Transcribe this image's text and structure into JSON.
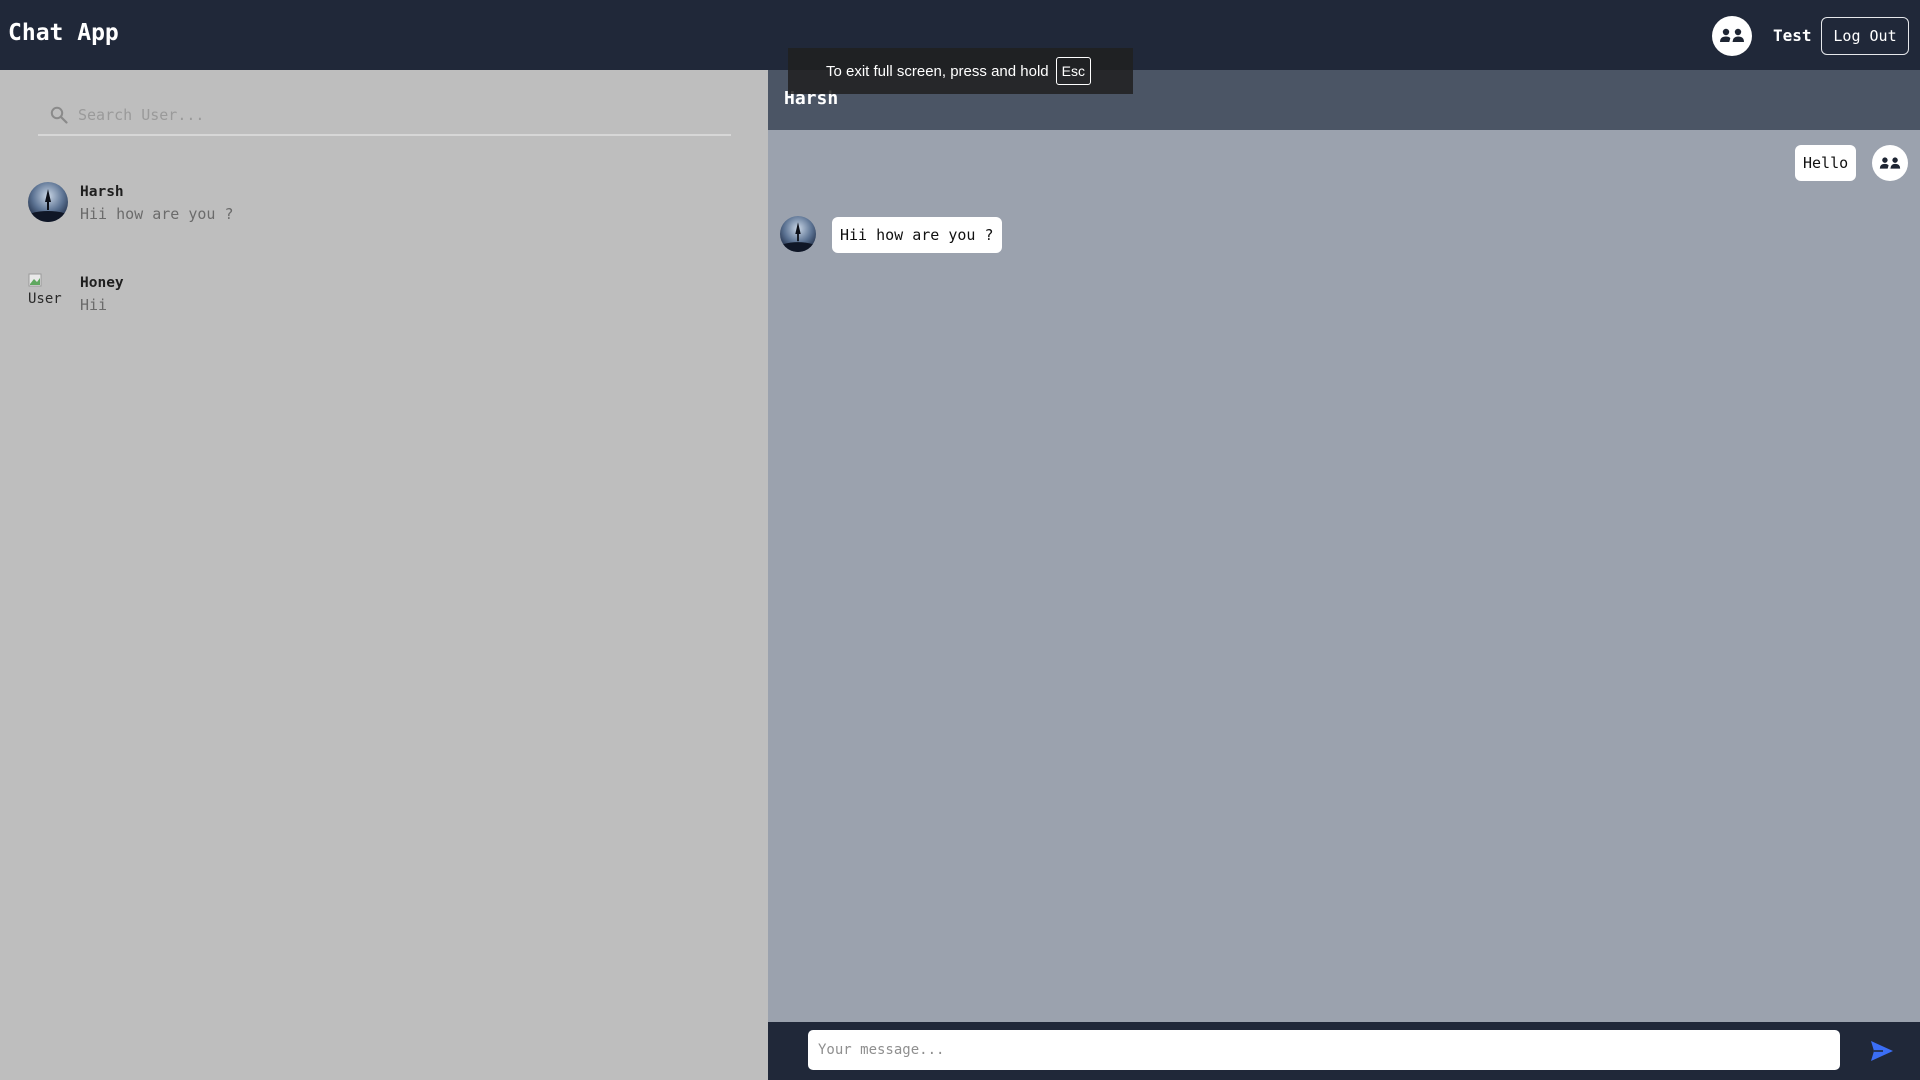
{
  "header": {
    "app_title": "Chat App",
    "current_user": "Test",
    "logout_label": "Log Out",
    "avatar_icon": "group-users-icon"
  },
  "sidebar": {
    "search_placeholder": "Search User...",
    "users": [
      {
        "name": "Harsh",
        "last_message": "Hii how are you ?",
        "avatar": "tree-night-photo"
      },
      {
        "name": "Honey",
        "last_message": "Hii",
        "avatar_alt": "User"
      }
    ]
  },
  "chat": {
    "recipient": "Harsh",
    "messages": [
      {
        "text": "Hello",
        "from": "me"
      },
      {
        "text": "Hii how are you ?",
        "from": "Harsh"
      }
    ],
    "input_placeholder": "Your message...",
    "send_icon": "send-icon"
  },
  "toast": {
    "text": "To exit full screen, press and hold",
    "key": "Esc"
  },
  "colors": {
    "navbar": "#202839",
    "chat_header": "#4b5565",
    "chat_bg": "#9ba2ae",
    "sidebar_bg": "#bebebe",
    "send_accent": "#3b6ef5"
  }
}
